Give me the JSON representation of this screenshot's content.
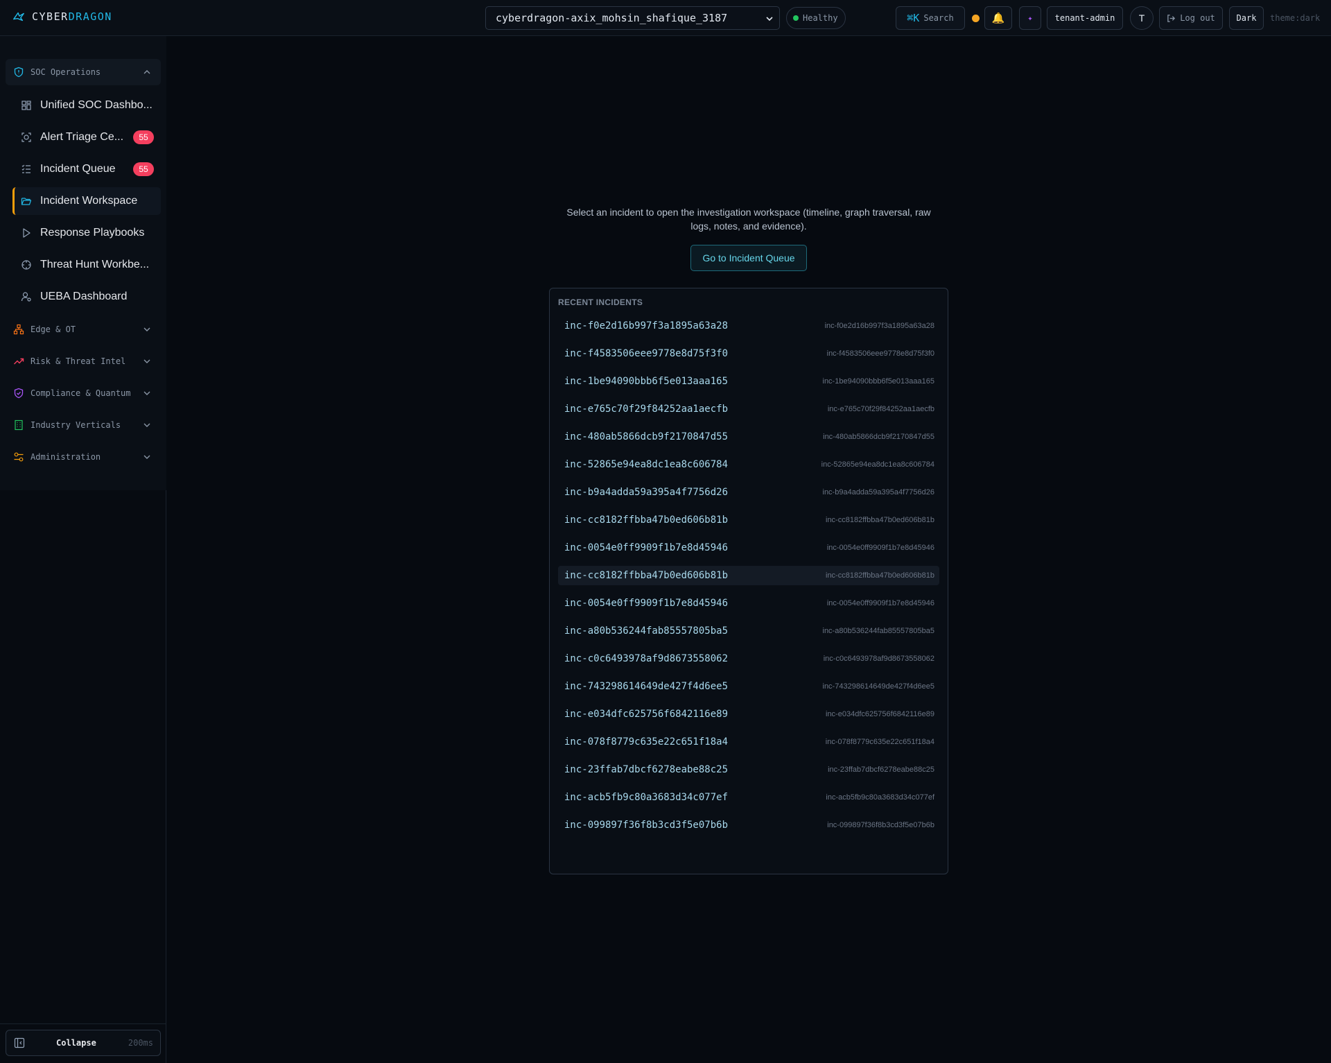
{
  "brand": {
    "prefix": "CYBER",
    "accent": "DRAGON"
  },
  "topbar": {
    "tenant": "cyberdragon-axix_mohsin_shafique_3187",
    "health": "Healthy",
    "search_kbd": "⌘K",
    "search_label": "Search",
    "bell": "🔔",
    "spark": "✦",
    "admin": "tenant-admin",
    "avatar": "T",
    "logout": "Log out",
    "theme_btn": "Dark",
    "theme_label": "theme:dark"
  },
  "sidebar": {
    "soc_group": "SOC Operations",
    "items": [
      {
        "label": "Unified SOC Dashbo..."
      },
      {
        "label": "Alert Triage Ce...",
        "badge": "55"
      },
      {
        "label": "Incident Queue",
        "badge": "55"
      },
      {
        "label": "Incident Workspace"
      },
      {
        "label": "Response Playbooks"
      },
      {
        "label": "Threat Hunt Workbe..."
      },
      {
        "label": "UEBA Dashboard"
      }
    ],
    "groups": [
      "Edge & OT",
      "Risk & Threat Intel",
      "Compliance & Quantum",
      "Industry Verticals",
      "Administration"
    ],
    "collapse_label": "Collapse",
    "collapse_ms": "200ms"
  },
  "main": {
    "empty_message": "Select an incident to open the investigation workspace (timeline, graph traversal, raw logs, notes, and evidence).",
    "queue_button": "Go to Incident Queue",
    "recent_title": "RECENT INCIDENTS",
    "incidents": [
      "inc-f0e2d16b997f3a1895a63a28",
      "inc-f4583506eee9778e8d75f3f0",
      "inc-1be94090bbb6f5e013aaa165",
      "inc-e765c70f29f84252aa1aecfb",
      "inc-480ab5866dcb9f2170847d55",
      "inc-52865e94ea8dc1ea8c606784",
      "inc-b9a4adda59a395a4f7756d26",
      "inc-cc8182ffbba47b0ed606b81b",
      "inc-0054e0ff9909f1b7e8d45946",
      "inc-cc8182ffbba47b0ed606b81b",
      "inc-0054e0ff9909f1b7e8d45946",
      "inc-a80b536244fab85557805ba5",
      "inc-c0c6493978af9d8673558062",
      "inc-743298614649de427f4d6ee5",
      "inc-e034dfc625756f6842116e89",
      "inc-078f8779c635e22c651f18a4",
      "inc-23ffab7dbcf6278eabe88c25",
      "inc-acb5fb9c80a3683d34c077ef",
      "inc-099897f36f8b3cd3f5e07b6b"
    ]
  }
}
